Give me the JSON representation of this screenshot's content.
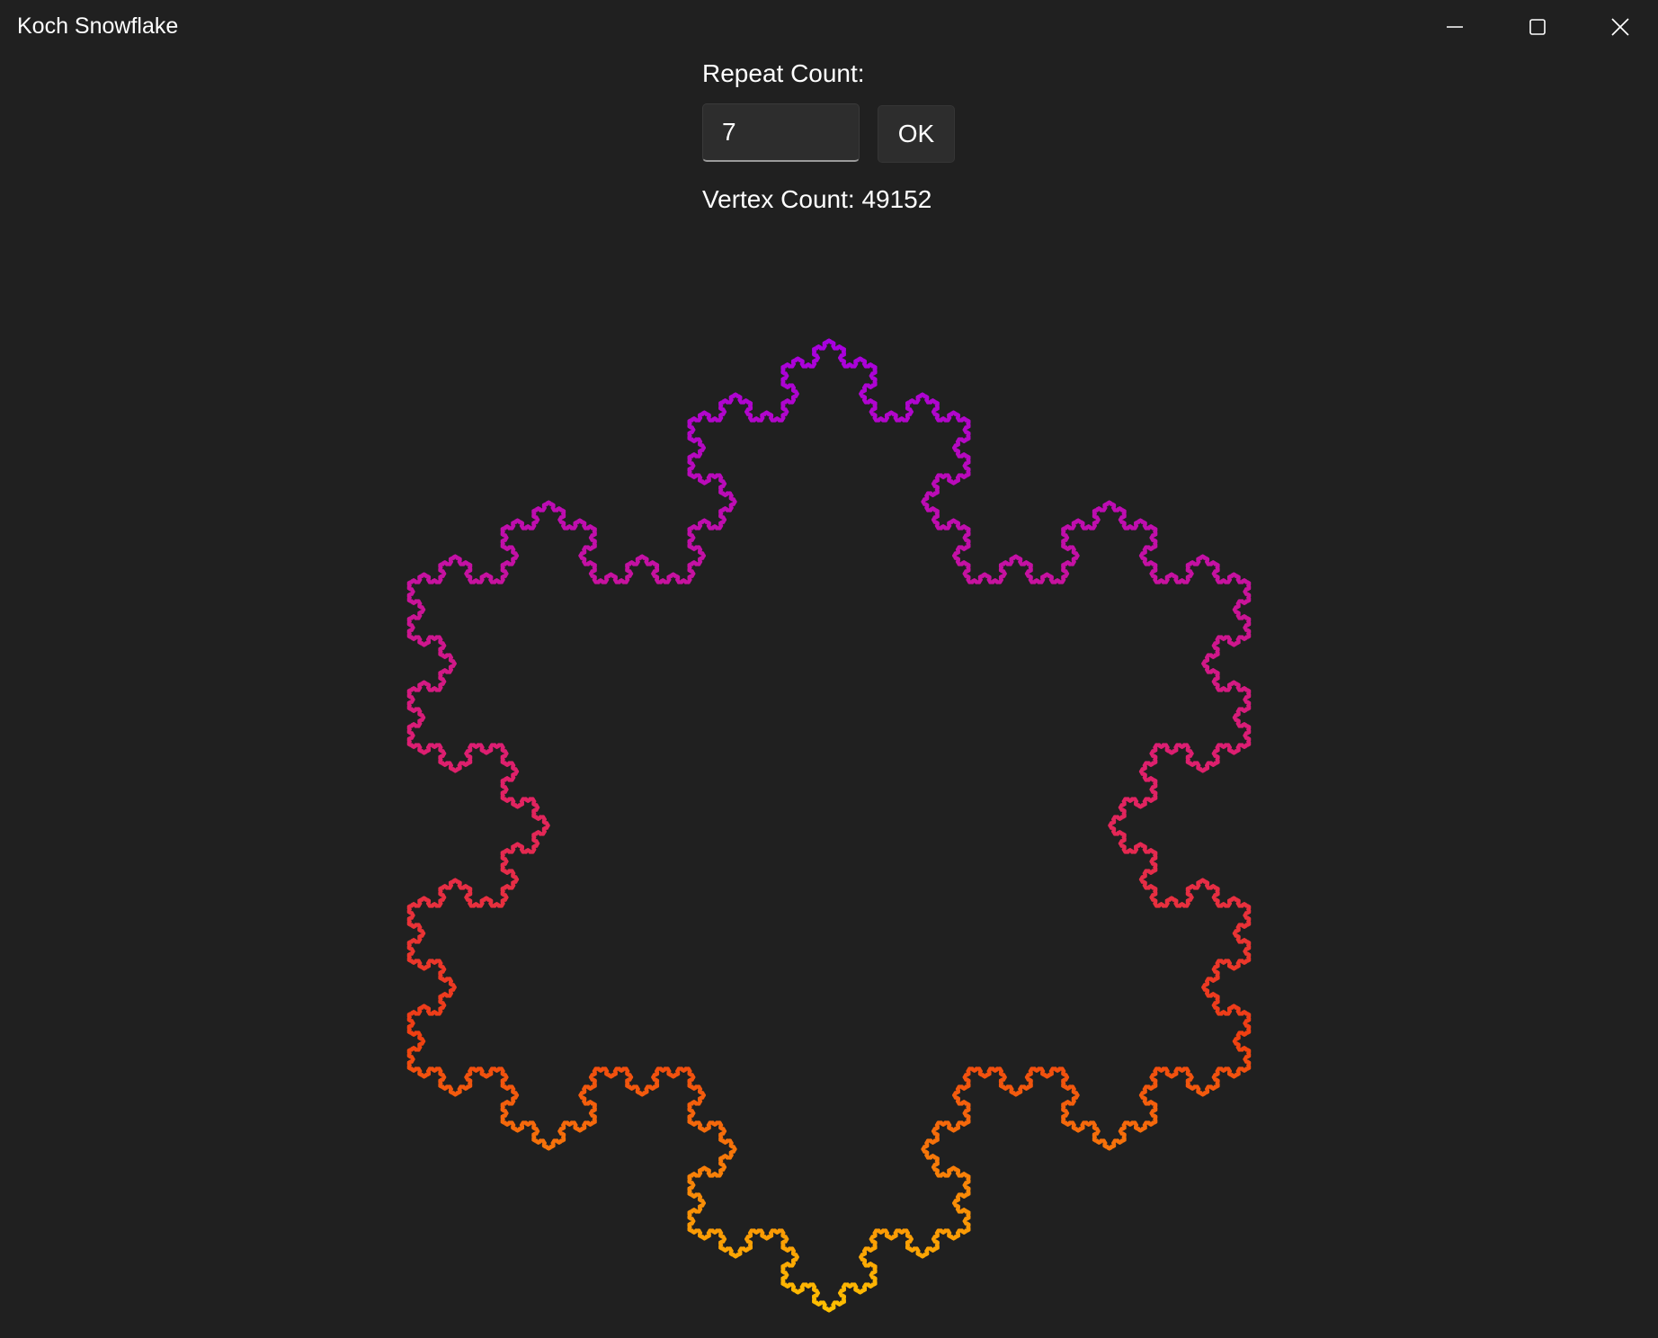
{
  "window": {
    "title": "Koch Snowflake",
    "controls": {
      "minimize_icon": "minimize-icon",
      "maximize_icon": "maximize-icon",
      "close_icon": "close-icon"
    }
  },
  "controls": {
    "repeat_label": "Repeat Count:",
    "repeat_value": "7",
    "ok_label": "OK",
    "vertex_label": "Vertex Count:",
    "vertex_value": "49152"
  },
  "snowflake": {
    "iterations": 7,
    "gradient": {
      "top": "#a800e0",
      "middle": "#e0206a",
      "lower": "#f04010",
      "bottom": "#ffc000"
    }
  },
  "colors": {
    "background": "#202020",
    "text": "#ffffff",
    "input_background": "#2d2d2d"
  }
}
